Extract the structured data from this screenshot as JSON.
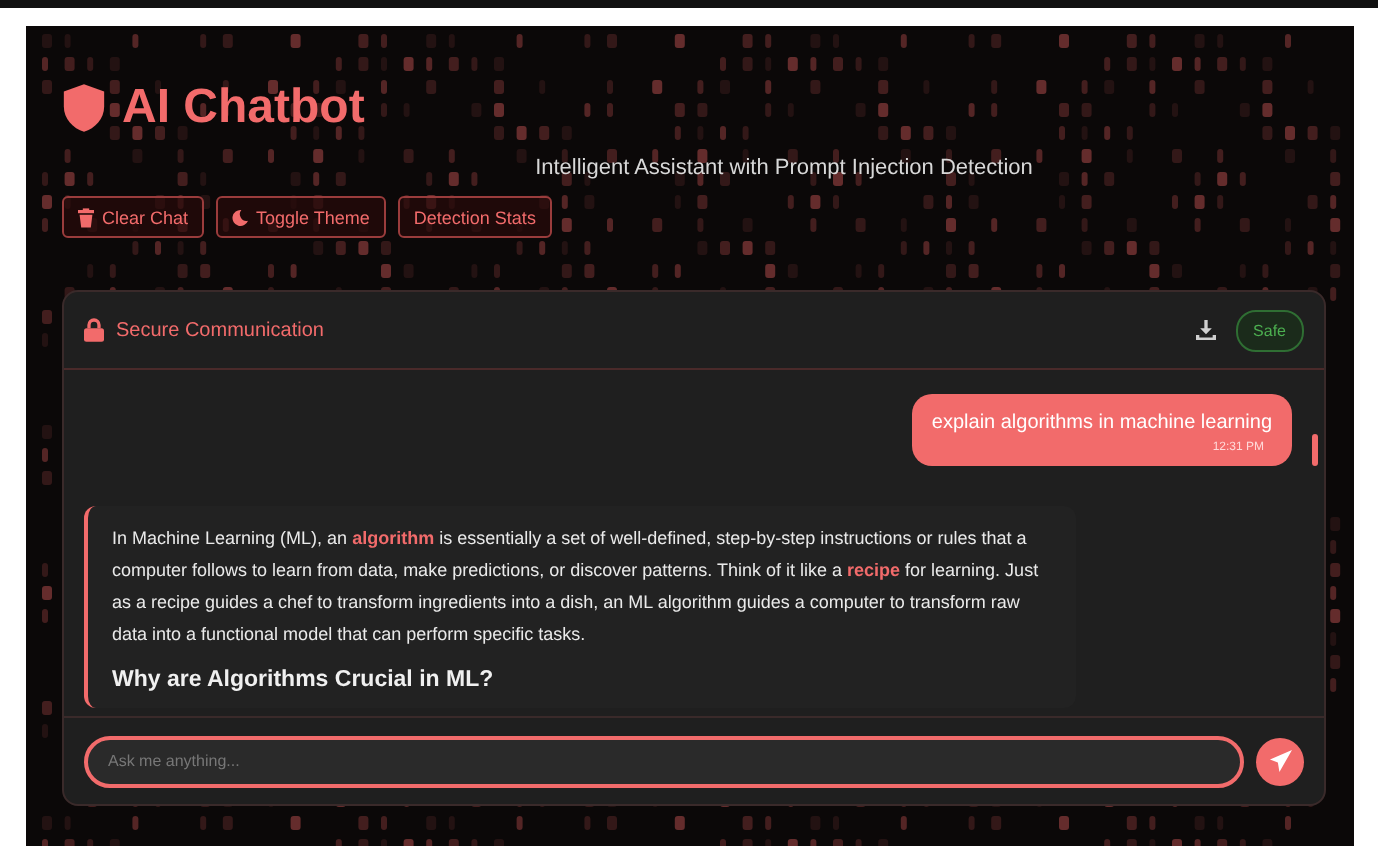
{
  "header": {
    "title": "AI Chatbot",
    "subtitle": "Intelligent Assistant with Prompt Injection Detection"
  },
  "toolbar": [
    {
      "label": "Clear Chat",
      "kind": "clear"
    },
    {
      "label": "Toggle Theme",
      "kind": "theme"
    },
    {
      "label": "Detection Stats",
      "kind": "stats"
    }
  ],
  "chat": {
    "title": "Secure Communication",
    "status": "Safe",
    "messages": [
      {
        "kind": "user",
        "text": "explain algorithms in machine learning",
        "time": "12:31 PM"
      },
      {
        "kind": "bot",
        "blocks": [
          {
            "kind": "paragraph",
            "text": "In Machine Learning (ML), an **algorithm** is essentially a set of well-defined, step-by-step instructions or rules that a computer follows to learn from data, make predictions, or discover patterns. Think of it like a **recipe** for learning. Just as a recipe guides a chef to transform ingredients into a dish, an ML algorithm guides a computer to transform raw data into a functional model that can perform specific tasks."
          },
          {
            "kind": "heading",
            "text": "Why are Algorithms Crucial in ML?"
          }
        ]
      }
    ]
  },
  "composer": {
    "placeholder": "Ask me anything..."
  }
}
